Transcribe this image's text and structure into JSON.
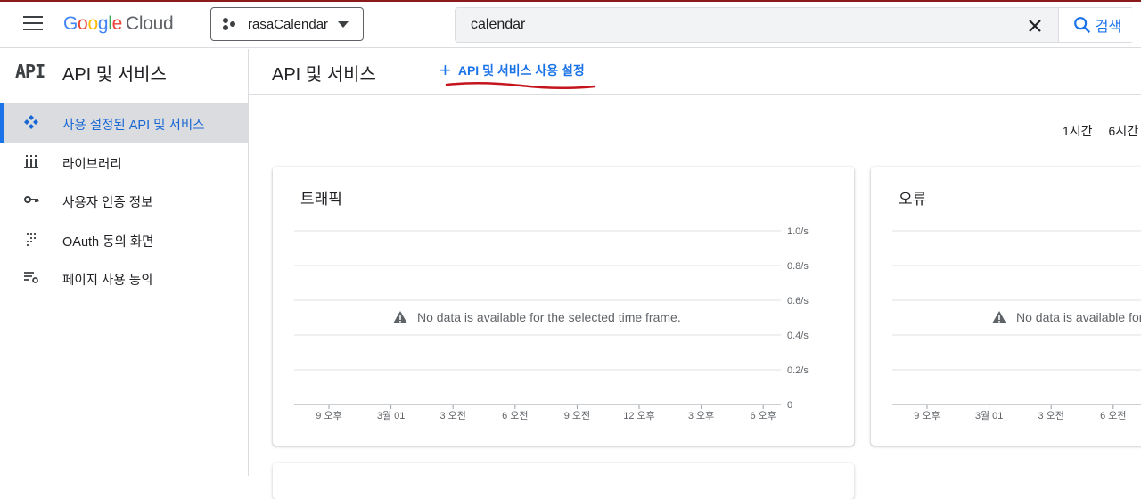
{
  "header": {
    "logo": {
      "letters": [
        "G",
        "o",
        "o",
        "g",
        "l",
        "e"
      ],
      "cloud": "Cloud"
    },
    "project": "rasaCalendar",
    "search": {
      "value": "calendar",
      "button_label": "검색"
    }
  },
  "sidebar": {
    "logo_text": "API",
    "title": "API 및 서비스",
    "items": [
      {
        "label": "사용 설정된 API 및 서비스",
        "icon": "diamond-dots-icon",
        "active": true
      },
      {
        "label": "라이브러리",
        "icon": "library-icon"
      },
      {
        "label": "사용자 인증 정보",
        "icon": "key-icon"
      },
      {
        "label": "OAuth 동의 화면",
        "icon": "dots-grid-icon"
      },
      {
        "label": "페이지 사용 동의",
        "icon": "settings-list-icon"
      }
    ]
  },
  "main": {
    "title": "API 및 서비스",
    "enable_button": "API 및 서비스 사용 설정",
    "time_ranges": [
      "1시간",
      "6시간"
    ]
  },
  "cards": {
    "traffic": {
      "title": "트래픽",
      "no_data": "No data is available for the selected time frame."
    },
    "errors": {
      "title": "오류",
      "no_data": "No data is available for the selected time frame."
    }
  },
  "chart_data": [
    {
      "type": "line",
      "title": "트래픽",
      "x": [
        "9 오후",
        "3월 01",
        "3 오전",
        "6 오전",
        "9 오전",
        "12 오후",
        "3 오후",
        "6 오후"
      ],
      "ytick_labels": [
        "1.0/s",
        "0.8/s",
        "0.6/s",
        "0.4/s",
        "0.2/s",
        "0"
      ],
      "ylim": [
        0,
        1.0
      ],
      "series": [],
      "grid": true
    },
    {
      "type": "line",
      "title": "오류",
      "x": [
        "9 오후",
        "3월 01",
        "3 오전",
        "6 오전"
      ],
      "series": [],
      "grid": true
    }
  ],
  "colors": {
    "accent": "#1a73e8",
    "annotation": "#c5141c",
    "active_bg": "#dadce0"
  }
}
